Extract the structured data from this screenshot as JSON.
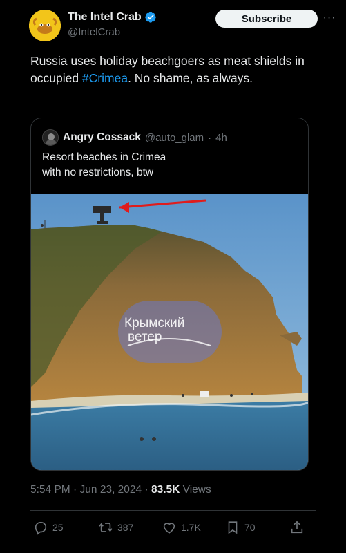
{
  "author": {
    "display_name": "The Intel Crab",
    "handle": "@IntelCrab",
    "subscribe_label": "Subscribe",
    "more_label": "···"
  },
  "tweet": {
    "text_before": "Russia uses holiday beachgoers as meat shields in occupied ",
    "hashtag": "#Crimea",
    "text_after": ". No shame, as always."
  },
  "quote": {
    "display_name": "Angry Cossack",
    "handle": "@auto_glam",
    "separator": "·",
    "time": "4h",
    "text_line1": "Resort beaches in Crimea",
    "text_line2": "with no restrictions, btw",
    "watermark_line1": "Крымский",
    "watermark_line2": "ветер"
  },
  "meta": {
    "time": "5:54 PM",
    "sep1": "·",
    "date": "Jun 23, 2024",
    "sep2": "·",
    "views_count": "83.5K",
    "views_label": "Views"
  },
  "actions": {
    "replies": "25",
    "reposts": "387",
    "likes": "1.7K",
    "bookmarks": "70"
  },
  "colors": {
    "accent": "#1d9bf0",
    "background": "#000000",
    "muted": "#71767b",
    "arrow": "#e01c1c"
  }
}
